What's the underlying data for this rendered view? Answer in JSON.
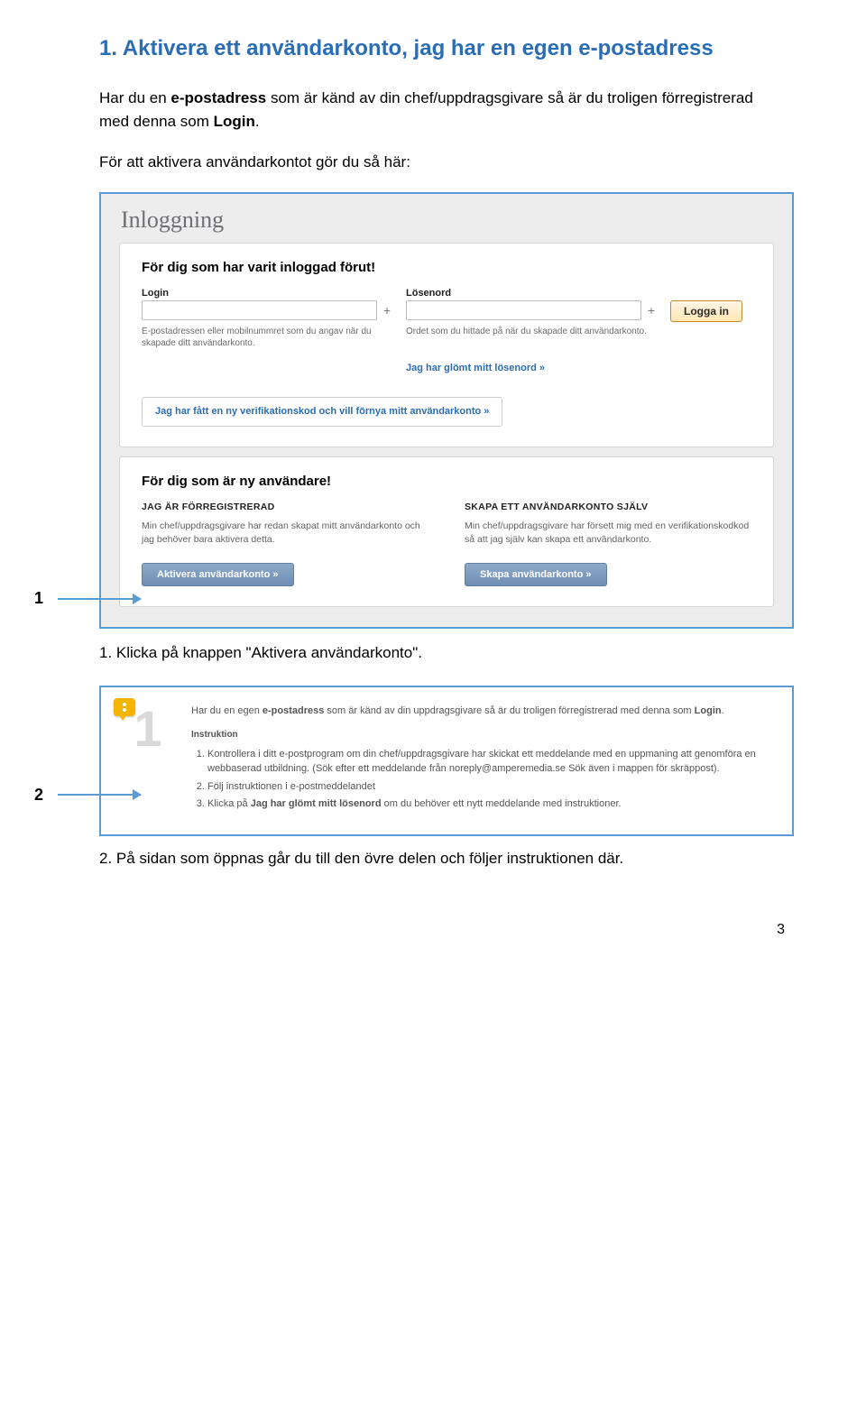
{
  "title": "1. Aktivera ett användarkonto, jag har en egen e-postadress",
  "intro": {
    "p1a": "Har du en ",
    "p1b": "e-postadress",
    "p1c": " som är känd av din chef/uppdragsgivare så är du troligen förregistrerad med denna som ",
    "p1d": "Login",
    "p1e": ".",
    "p2": "För att aktivera användarkontot gör du så här:"
  },
  "callouts": {
    "one": "1",
    "two": "2"
  },
  "frame1": {
    "header": "Inloggning",
    "panel1": {
      "title": "För dig som har varit inloggad förut!",
      "login_label": "Login",
      "login_help": "E-postadressen eller mobilnummret som du angav när du skapade ditt användarkonto.",
      "pass_label": "Lösenord",
      "pass_help": "Ordet som du hittade på när du skapade ditt användarkonto.",
      "login_btn": "Logga in",
      "forgot": "Jag har glömt mitt lösenord »",
      "verify": "Jag har fått en ny verifikationskod och vill förnya mitt användarkonto »"
    },
    "panel2": {
      "title": "För dig som är ny användare!",
      "left_h": "JAG ÄR FÖRREGISTRERAD",
      "left_p": "Min chef/uppdragsgivare har redan skapat mitt användarkonto och jag behöver bara aktivera detta.",
      "left_btn": "Aktivera användarkonto »",
      "right_h": "SKAPA ETT ANVÄNDARKONTO SJÄLV",
      "right_p": "Min chef/uppdragsgivare har försett mig med en verifikationskodkod så att jag själv kan skapa ett användarkonto.",
      "right_btn": "Skapa användarkonto »"
    }
  },
  "step1": "1. Klicka på knappen \"Aktivera användarkonto\".",
  "frame2": {
    "big": "1",
    "lead_a": "Har du en egen ",
    "lead_b": "e-postadress",
    "lead_c": " som är känd av din uppdragsgivare så är du troligen förregistrerad med denna som ",
    "lead_d": "Login",
    "lead_e": ".",
    "instr_h": "Instruktion",
    "li1": "Kontrollera i ditt e-postprogram om din chef/uppdragsgivare har skickat ett meddelande med en uppmaning att genomföra en webbaserad utbildning. (Sök efter ett meddelande från noreply@amperemedia.se Sök även i mappen för skräppost).",
    "li2": "Följ instruktionen i e-postmeddelandet",
    "li3a": "Klicka på ",
    "li3b": "Jag har glömt mitt lösenord",
    "li3c": " om du behöver ett nytt meddelande med instruktioner."
  },
  "step2": "2. På sidan som öppnas går du till den övre delen och följer instruktionen där.",
  "page_num": "3"
}
